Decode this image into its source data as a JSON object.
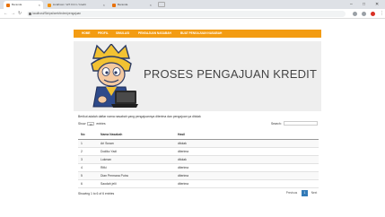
{
  "browser": {
    "tabs": [
      {
        "label": "Beranda",
        "fav_color": "#e8710a"
      },
      {
        "label": "localhost / 127.0.0.1 / kredit",
        "fav_color": "#f29111"
      },
      {
        "label": "Beranda",
        "fav_color": "#e8710a"
      }
    ],
    "url": "localhost/Skripsi/web/index/pengajuan"
  },
  "nav": {
    "items": [
      "HOME",
      "PROFIL",
      "SIMULASI",
      "PENGAJUAN NASABAH",
      "BUAT PENGAJUAN NASABAH"
    ],
    "color": "#f39c12"
  },
  "banner": {
    "title": "PROSES PENGAJUAN KREDIT"
  },
  "content": {
    "description": "Berikut adalah daftar nama nasabah yang pengajuannya diterima dan pengajuan ya ditolak",
    "show_label": "Show",
    "show_value": "10",
    "entries_label": "entries",
    "search_label": "Search:"
  },
  "table": {
    "headers": [
      "No",
      "Nama Nasabah",
      "Hasil"
    ],
    "rows": [
      [
        "1",
        "Ari Susan",
        "ditolak"
      ],
      [
        "2",
        "Dodiko Yadi",
        "diterima"
      ],
      [
        "3",
        "Lukman",
        "ditolak"
      ],
      [
        "4",
        "Rifki",
        "diterima"
      ],
      [
        "5",
        "Dian Permana Putra",
        "diterima"
      ],
      [
        "6",
        "Saodah jelii",
        "diterima"
      ]
    ]
  },
  "footer": {
    "info": "Showing 1 to 6 of 6 entries",
    "prev": "Previous",
    "page": "1",
    "next": "Next"
  }
}
